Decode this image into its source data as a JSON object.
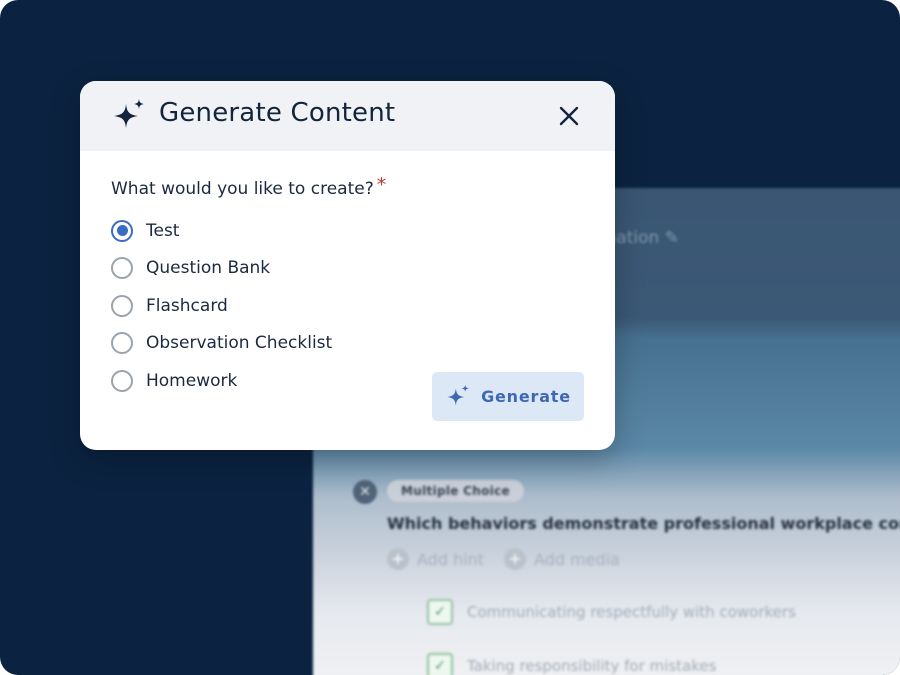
{
  "colors": {
    "backdrop": "#0b2340",
    "accent": "#3b6cc4",
    "required": "#c0392b",
    "generate_bg": "#dde8f7"
  },
  "modal": {
    "icon": "sparkle-icon",
    "title": "Generate Content",
    "close_icon": "close-icon",
    "prompt": "What would you like to create?",
    "required_marker": "*",
    "options": [
      {
        "label": "Test",
        "selected": true
      },
      {
        "label": "Question Bank",
        "selected": false
      },
      {
        "label": "Flashcard",
        "selected": false
      },
      {
        "label": "Observation Checklist",
        "selected": false
      },
      {
        "label": "Homework",
        "selected": false
      }
    ],
    "generate_button": {
      "label": "Generate",
      "icon": "sparkle-icon"
    }
  },
  "background": {
    "title_fragment": "nination ✎",
    "question": {
      "remove_icon": "close-icon",
      "type_tag": "Multiple Choice",
      "text": "Which behaviors demonstrate professional workplace conduct",
      "actions": [
        {
          "label": "Add hint",
          "icon": "plus-circle-icon"
        },
        {
          "label": "Add media",
          "icon": "plus-circle-icon"
        }
      ],
      "answers": [
        {
          "text": "Communicating respectfully with coworkers",
          "checked": true
        },
        {
          "text": "Taking responsibility for mistakes",
          "checked": true
        }
      ]
    }
  }
}
